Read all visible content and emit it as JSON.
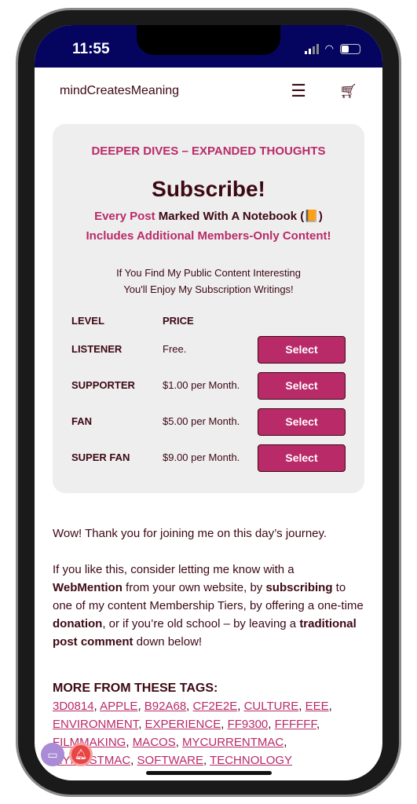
{
  "status": {
    "time": "11:55"
  },
  "nav": {
    "brand": "mindCreatesMeaning",
    "menu_icon": "hamburger-icon",
    "cart_icon": "cart-icon"
  },
  "card": {
    "kicker": "DEEPER DIVES – EXPANDED THOUGHTS",
    "title": "Subscribe!",
    "line1_pink": "Every Post",
    "line1_rest": "Marked With A Notebook (",
    "notebook_icon": "📙",
    "line1_close": ")",
    "line2": "Includes Additional Members-Only Content!",
    "note1": "If You Find My Public Content Interesting",
    "note2": "You'll Enjoy My Subscription Writings!",
    "headers": {
      "level": "LEVEL",
      "price": "PRICE"
    },
    "tiers": [
      {
        "level": "LISTENER",
        "price": "Free.",
        "button": "Select"
      },
      {
        "level": "SUPPORTER",
        "price": "$1.00 per Month.",
        "button": "Select"
      },
      {
        "level": "FAN",
        "price": "$5.00 per Month.",
        "button": "Select"
      },
      {
        "level": "SUPER FAN",
        "price": "$9.00 per Month.",
        "button": "Select"
      }
    ]
  },
  "body": {
    "p1": "Wow! Thank you for joining me on this day’s journey.",
    "p2": [
      "If you like this, consider letting me know with a ",
      "WebMention",
      " from your own website, by ",
      "subscribing",
      " to one of my content Membership Tiers, by offering a one-time ",
      "donation",
      ", or if you’re old school – by leaving a ",
      "traditional post comment",
      " down below!"
    ]
  },
  "tags": {
    "heading": "MORE FROM THESE TAGS:",
    "items": [
      "3D0814",
      "APPLE",
      "B92A68",
      "CF2E2E",
      "CULTURE",
      "EEE",
      "ENVIRONMENT",
      "EXPERIENCE",
      "FF9300",
      "FFFFFF",
      "FILMMAKING",
      "MACOS",
      "MYCURRENTMAC",
      "MYFIRSTMAC",
      "SOFTWARE",
      "TECHNOLOGY"
    ]
  },
  "colors": {
    "primary": "#3D0814",
    "accent": "#B92A68",
    "card": "#EEEEEE",
    "status_bar": "#050560"
  }
}
